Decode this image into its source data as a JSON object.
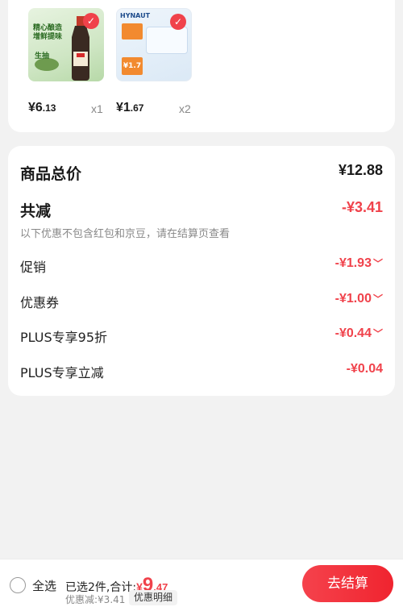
{
  "products": [
    {
      "image_text": "精心酿造 增鲜提味",
      "sub_text": "生抽",
      "price_int": "¥6",
      "price_dec": ".13",
      "qty": "x1"
    },
    {
      "image_brand": "HYNAUT",
      "price_int": "¥1",
      "price_dec": ".67",
      "qty": "x2",
      "image_price": "¥1.7"
    }
  ],
  "summary": {
    "total_label": "商品总价",
    "total_value": "¥12.88",
    "reduce_label": "共减",
    "reduce_value": "-¥3.41",
    "note": "以下优惠不包含红包和京豆，请在结算页查看",
    "items": [
      {
        "label": "促销",
        "value": "-¥1.93",
        "has_chevron": true
      },
      {
        "label": "优惠券",
        "value": "-¥1.00",
        "has_chevron": true
      },
      {
        "label": "PLUS专享95折",
        "value": "-¥0.44",
        "has_chevron": true
      },
      {
        "label": "PLUS专享立减",
        "value": "-¥0.04",
        "has_chevron": false
      }
    ]
  },
  "bottom_bar": {
    "select_all_label": "全选",
    "selected_text": "已选2件,合计:",
    "currency": "¥",
    "total_int": "9",
    "total_dec": ".47",
    "discount_text": "优惠减:¥3.41",
    "detail_label": "优惠明细",
    "checkout_label": "去结算"
  },
  "colors": {
    "accent": "#f0424b",
    "background": "#f2f2f2"
  }
}
